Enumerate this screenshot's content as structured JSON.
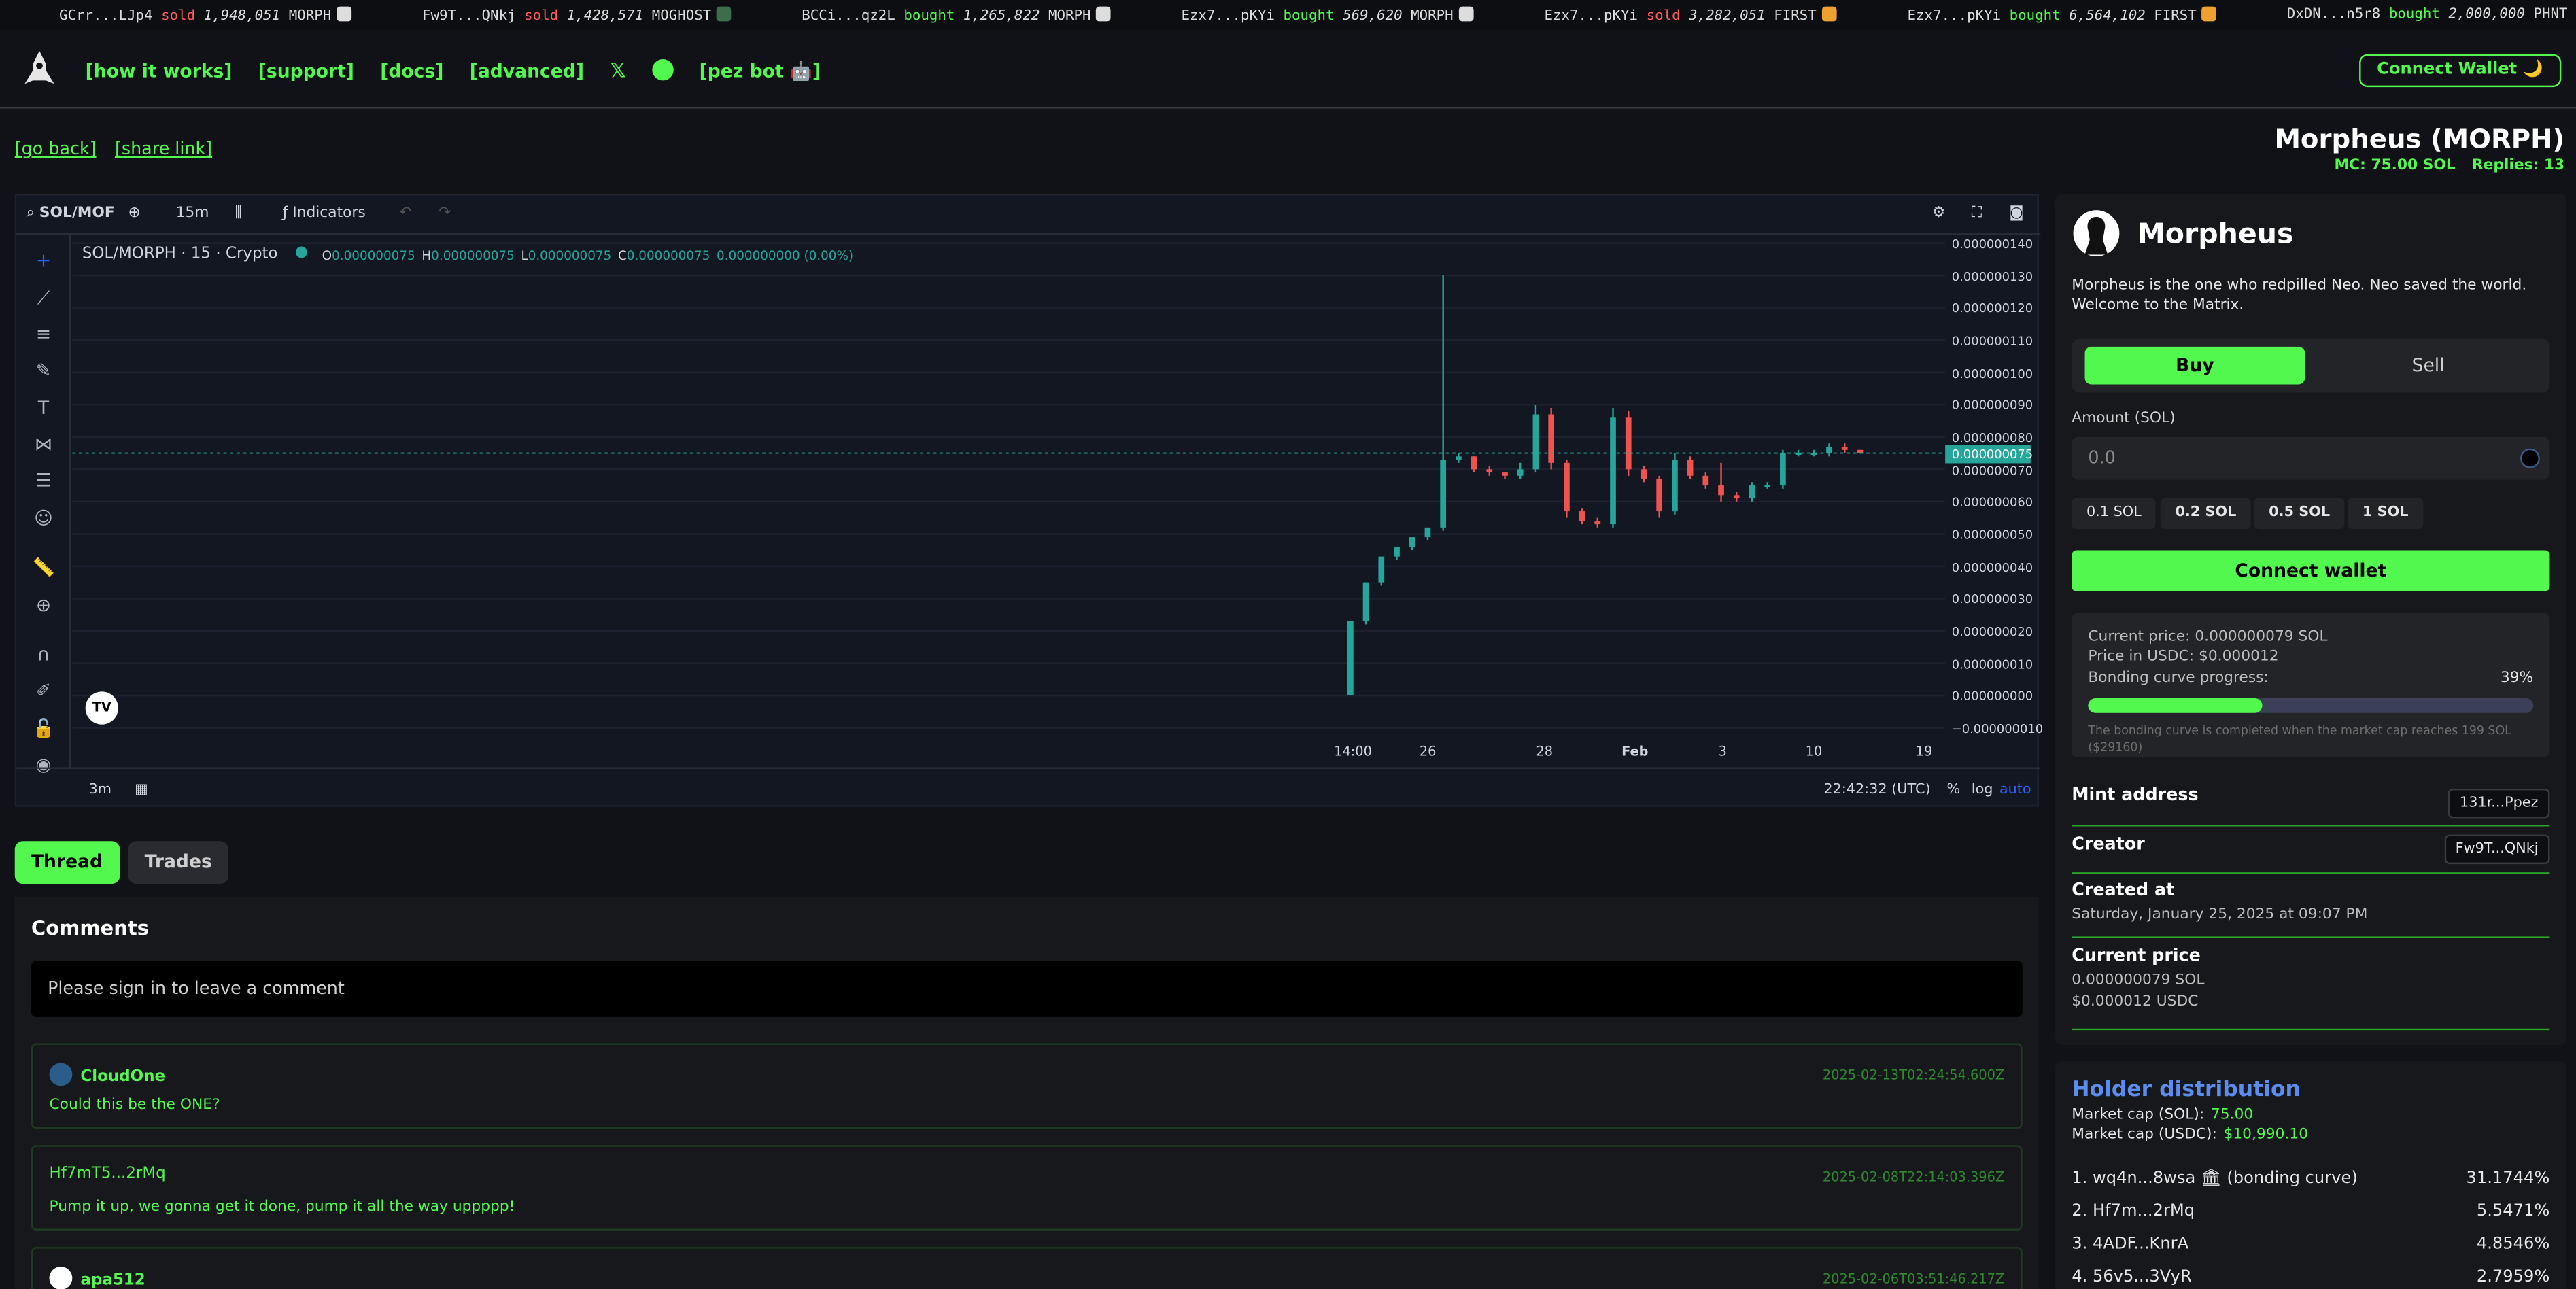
{
  "ticker": [
    {
      "who": "GCrr...LJp4",
      "action": "sold",
      "amount": "1,948,051",
      "token": "MORPH",
      "color": "#dddddd"
    },
    {
      "who": "Fw9T...QNkj",
      "action": "sold",
      "amount": "1,428,571",
      "token": "MOGHOST",
      "color": "#3b6e4b"
    },
    {
      "who": "BCCi...qz2L",
      "action": "bought",
      "amount": "1,265,822",
      "token": "MORPH",
      "color": "#dddddd"
    },
    {
      "who": "Ezx7...pKYi",
      "action": "bought",
      "amount": "569,620",
      "token": "MORPH",
      "color": "#dddddd"
    },
    {
      "who": "Ezx7...pKYi",
      "action": "sold",
      "amount": "3,282,051",
      "token": "FIRST",
      "color": "#f0a030"
    },
    {
      "who": "Ezx7...pKYi",
      "action": "bought",
      "amount": "6,564,102",
      "token": "FIRST",
      "color": "#f0a030"
    },
    {
      "who": "DxDN...n5r8",
      "action": "bought",
      "amount": "2,000,000",
      "token": "PHNT",
      "color": "#dddddd"
    }
  ],
  "nav": {
    "links": [
      "[how it works]",
      "[support]",
      "[docs]",
      "[advanced]"
    ],
    "x_label": "𝕏",
    "pez_bot": "[pez bot 🤖]",
    "connect": "Connect Wallet 🌙"
  },
  "header": {
    "go_back": "[go back]",
    "share_link": "[share link]",
    "title": "Morpheus (MORPH)",
    "mc": "MC: 75.00 SOL",
    "replies": "Replies: 13"
  },
  "chart_toolbar": {
    "symbol": "SOL/MOF",
    "interval": "15m",
    "indicators": "Indicators",
    "pair_label": "SOL/MORPH · 15 · Crypto",
    "ohlc": {
      "o": "0.000000075",
      "h": "0.000000075",
      "l": "0.000000075",
      "c": "0.000000075",
      "chg": "0.000000000 (0.00%)"
    },
    "range": "3m",
    "clock": "22:42:32 (UTC)",
    "pct": "%",
    "log": "log",
    "auto": "auto"
  },
  "chart_data": {
    "type": "candlestick",
    "y_ticks": [
      "0.000000140",
      "0.000000130",
      "0.000000120",
      "0.000000110",
      "0.000000100",
      "0.000000090",
      "0.000000080",
      "0.000000070",
      "0.000000060",
      "0.000000050",
      "0.000000040",
      "0.000000030",
      "0.000000020",
      "0.000000010",
      "0.000000000",
      "−0.000000010"
    ],
    "x_ticks": [
      "14:00",
      "26",
      "28",
      "Feb",
      "3",
      "10",
      "19"
    ],
    "ylim": [
      -1e-08,
      1.4e-07
    ],
    "last_price": "0.000000075",
    "candles": [
      {
        "o": 0.0,
        "h": 2.3e-08,
        "l": 0.0,
        "c": 2.3e-08
      },
      {
        "o": 2.3e-08,
        "h": 3.5e-08,
        "l": 2.2e-08,
        "c": 3.5e-08
      },
      {
        "o": 3.5e-08,
        "h": 4.3e-08,
        "l": 3.4e-08,
        "c": 4.3e-08
      },
      {
        "o": 4.3e-08,
        "h": 4.6e-08,
        "l": 4.2e-08,
        "c": 4.6e-08
      },
      {
        "o": 4.6e-08,
        "h": 4.9e-08,
        "l": 4.5e-08,
        "c": 4.9e-08
      },
      {
        "o": 4.9e-08,
        "h": 5.2e-08,
        "l": 4.8e-08,
        "c": 5.2e-08
      },
      {
        "o": 5.2e-08,
        "h": 1.3e-07,
        "l": 5.1e-08,
        "c": 7.3e-08
      },
      {
        "o": 7.3e-08,
        "h": 7.5e-08,
        "l": 7.2e-08,
        "c": 7.4e-08
      },
      {
        "o": 7.4e-08,
        "h": 7.4e-08,
        "l": 6.9e-08,
        "c": 7e-08
      },
      {
        "o": 7e-08,
        "h": 7.1e-08,
        "l": 6.8e-08,
        "c": 6.9e-08
      },
      {
        "o": 6.9e-08,
        "h": 6.9e-08,
        "l": 6.7e-08,
        "c": 6.8e-08
      },
      {
        "o": 6.8e-08,
        "h": 7.2e-08,
        "l": 6.7e-08,
        "c": 7e-08
      },
      {
        "o": 7e-08,
        "h": 9e-08,
        "l": 6.9e-08,
        "c": 8.7e-08
      },
      {
        "o": 8.7e-08,
        "h": 8.9e-08,
        "l": 7e-08,
        "c": 7.2e-08
      },
      {
        "o": 7.2e-08,
        "h": 7.3e-08,
        "l": 5.5e-08,
        "c": 5.7e-08
      },
      {
        "o": 5.7e-08,
        "h": 5.8e-08,
        "l": 5.3e-08,
        "c": 5.4e-08
      },
      {
        "o": 5.4e-08,
        "h": 5.5e-08,
        "l": 5.2e-08,
        "c": 5.3e-08
      },
      {
        "o": 5.3e-08,
        "h": 8.9e-08,
        "l": 5.2e-08,
        "c": 8.6e-08
      },
      {
        "o": 8.6e-08,
        "h": 8.8e-08,
        "l": 6.8e-08,
        "c": 7e-08
      },
      {
        "o": 7e-08,
        "h": 7.1e-08,
        "l": 6.6e-08,
        "c": 6.7e-08
      },
      {
        "o": 6.7e-08,
        "h": 6.8e-08,
        "l": 5.5e-08,
        "c": 5.7e-08
      },
      {
        "o": 5.7e-08,
        "h": 7.5e-08,
        "l": 5.6e-08,
        "c": 7.3e-08
      },
      {
        "o": 7.3e-08,
        "h": 7.4e-08,
        "l": 6.7e-08,
        "c": 6.8e-08
      },
      {
        "o": 6.8e-08,
        "h": 6.9e-08,
        "l": 6.4e-08,
        "c": 6.5e-08
      },
      {
        "o": 6.5e-08,
        "h": 7.2e-08,
        "l": 6e-08,
        "c": 6.2e-08
      },
      {
        "o": 6.2e-08,
        "h": 6.3e-08,
        "l": 6e-08,
        "c": 6.1e-08
      },
      {
        "o": 6.1e-08,
        "h": 6.6e-08,
        "l": 6e-08,
        "c": 6.5e-08
      },
      {
        "o": 6.5e-08,
        "h": 6.6e-08,
        "l": 6.4e-08,
        "c": 6.5e-08
      },
      {
        "o": 6.5e-08,
        "h": 7.6e-08,
        "l": 6.4e-08,
        "c": 7.5e-08
      },
      {
        "o": 7.5e-08,
        "h": 7.6e-08,
        "l": 7.4e-08,
        "c": 7.5e-08
      },
      {
        "o": 7.5e-08,
        "h": 7.6e-08,
        "l": 7.4e-08,
        "c": 7.5e-08
      },
      {
        "o": 7.5e-08,
        "h": 7.8e-08,
        "l": 7.4e-08,
        "c": 7.7e-08
      },
      {
        "o": 7.7e-08,
        "h": 7.8e-08,
        "l": 7.5e-08,
        "c": 7.6e-08
      },
      {
        "o": 7.6e-08,
        "h": 7.6e-08,
        "l": 7.5e-08,
        "c": 7.5e-08
      }
    ]
  },
  "tabs": {
    "thread": "Thread",
    "trades": "Trades"
  },
  "comments": {
    "title": "Comments",
    "signin": "Please sign in to leave a comment",
    "items": [
      {
        "user": "CloudOne",
        "time": "2025-02-13T02:24:54.600Z",
        "text": "Could this be the ONE?"
      },
      {
        "user": "Hf7mT5...2rMq",
        "time": "2025-02-08T22:14:03.396Z",
        "text": "Pump it up, we gonna get it done, pump it all the way uppppp!"
      },
      {
        "user": "apa512",
        "time": "2025-02-06T03:51:46.217Z",
        "text": ""
      }
    ]
  },
  "token": {
    "name": "Morpheus",
    "description": "Morpheus is the one who redpilled Neo. Neo saved the world. Welcome to the Matrix.",
    "buy": "Buy",
    "sell": "Sell",
    "amount_label": "Amount (SOL)",
    "amount_placeholder": "0.0",
    "quick": [
      "0.1 SOL",
      "0.2 SOL",
      "0.5 SOL",
      "1 SOL"
    ],
    "connect": "Connect wallet",
    "current_price": "Current price: 0.000000079 SOL",
    "price_usdc": "Price in USDC: $0.000012",
    "bonding_label": "Bonding curve progress:",
    "bonding_pct": "39%",
    "bonding_value": 0.39,
    "bonding_note": "The bonding curve is completed when the market cap reaches 199 SOL ($29160)",
    "mint_label": "Mint address",
    "mint": "131r...Ppez",
    "creator_label": "Creator",
    "creator": "Fw9T...QNkj",
    "created_label": "Created at",
    "created": "Saturday, January 25, 2025 at 09:07 PM",
    "cprice_label": "Current price",
    "cprice_sol": "0.000000079 SOL",
    "cprice_usdc": "$0.000012 USDC"
  },
  "holders": {
    "title": "Holder distribution",
    "mc_sol_label": "Market cap (SOL):",
    "mc_sol": "75.00",
    "mc_usdc_label": "Market cap (USDC):",
    "mc_usdc": "$10,990.10",
    "rows": [
      {
        "label": "1. wq4n...8wsa 🏛 (bonding curve)",
        "pct": "31.1744%"
      },
      {
        "label": "2. Hf7m...2rMq",
        "pct": "5.5471%"
      },
      {
        "label": "3. 4ADF...KnrA",
        "pct": "4.8546%"
      },
      {
        "label": "4. 56v5...3VyR",
        "pct": "2.7959%"
      }
    ]
  }
}
